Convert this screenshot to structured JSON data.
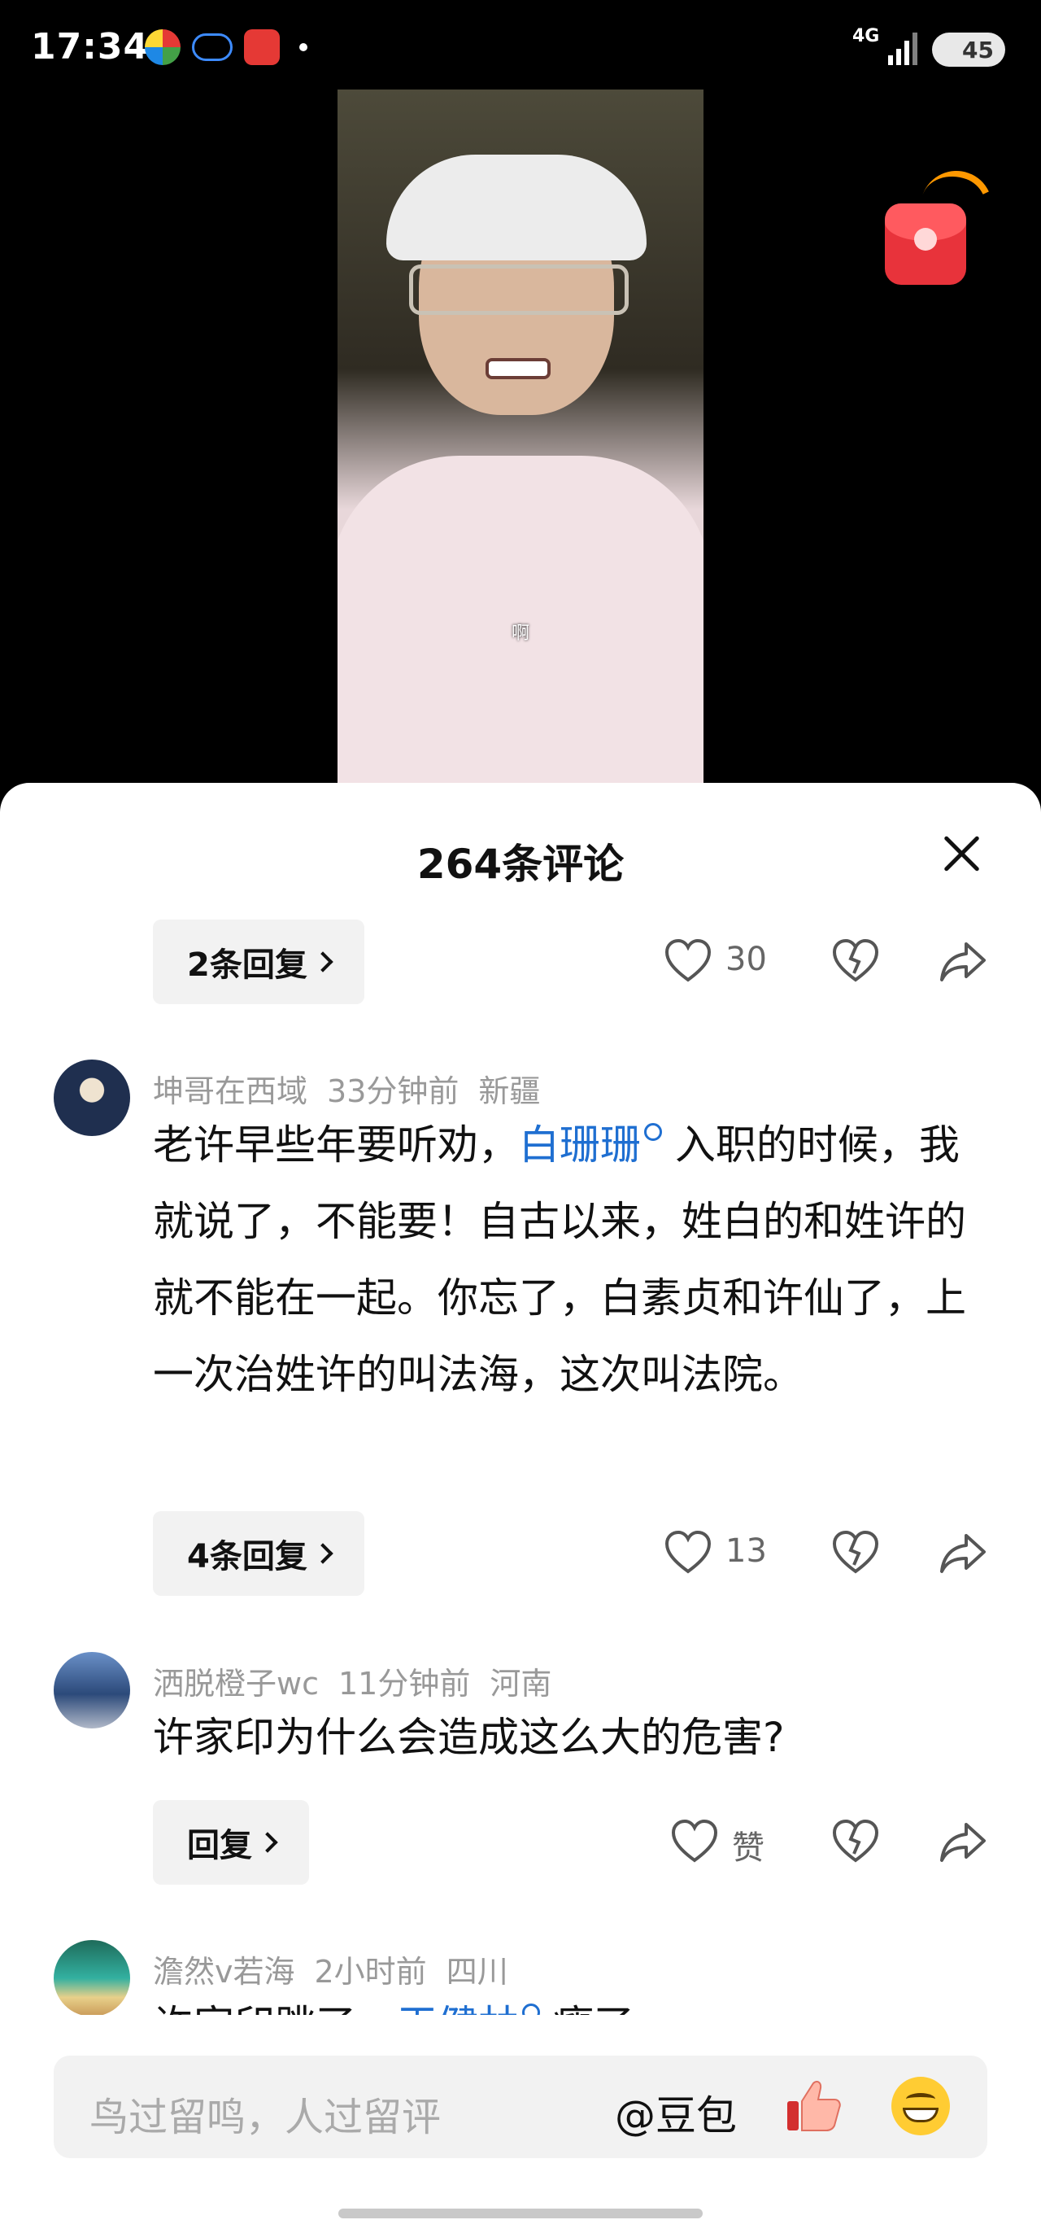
{
  "status_bar": {
    "time": "17:34",
    "network": "4G",
    "battery": "45"
  },
  "video": {
    "subtitle": "啊"
  },
  "comments_sheet": {
    "title": "264条评论",
    "first_thread": {
      "reply_label": "2条回复",
      "likes": "30"
    },
    "comments": [
      {
        "user": "坤哥在西域",
        "time": "33分钟前",
        "location": "新疆",
        "text_before": "老许早些年要听劝，",
        "link": "白珊珊",
        "text_after": " 入职的时候，我就说了，不能要！自古以来，姓白的和姓许的就不能在一起。你忘了，白素贞和许仙了，上一次治姓许的叫法海，这次叫法院。",
        "reply_label": "4条回复",
        "likes": "13"
      },
      {
        "user": "洒脱橙子wc",
        "time": "11分钟前",
        "location": "河南",
        "text": "许家印为什么会造成这么大的危害?",
        "reply_label": "回复",
        "likes": "赞"
      },
      {
        "user": "澹然v若海",
        "time": "2小时前",
        "location": "四川",
        "text_before": "许家印跳了，",
        "link": "王健林",
        "text_after": " 瘦了"
      }
    ]
  },
  "input_bar": {
    "placeholder": "鸟过留鸣，人过留评",
    "mention": "@豆包"
  }
}
